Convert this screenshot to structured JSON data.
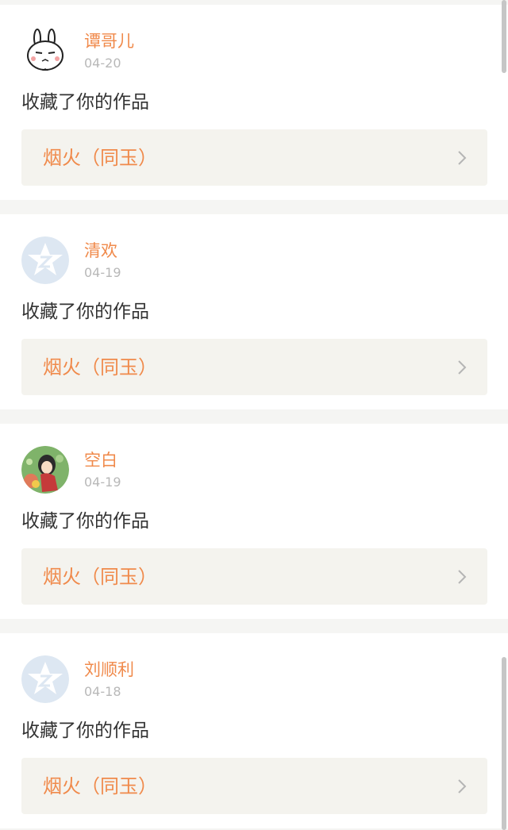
{
  "feed": {
    "items": [
      {
        "username": "谭哥儿",
        "date": "04-20",
        "action": "收藏了你的作品",
        "work_title": "烟火（同玉）",
        "avatar_type": "rabbit-cartoon-avatar"
      },
      {
        "username": "清欢",
        "date": "04-19",
        "action": "收藏了你的作品",
        "work_title": "烟火（同玉）",
        "avatar_type": "default-qzone-avatar"
      },
      {
        "username": "空白",
        "date": "04-19",
        "action": "收藏了你的作品",
        "work_title": "烟火（同玉）",
        "avatar_type": "anime-girl-avatar"
      },
      {
        "username": "刘顺利",
        "date": "04-18",
        "action": "收藏了你的作品",
        "work_title": "烟火（同玉）",
        "avatar_type": "default-qzone-avatar"
      }
    ]
  },
  "colors": {
    "accent": "#f08a4b",
    "date": "#b8b8b8",
    "text": "#333333",
    "link_bg": "#f4f3ee",
    "page_bg": "#f5f5f3"
  },
  "icons": {
    "chevron": "chevron-right-icon"
  }
}
